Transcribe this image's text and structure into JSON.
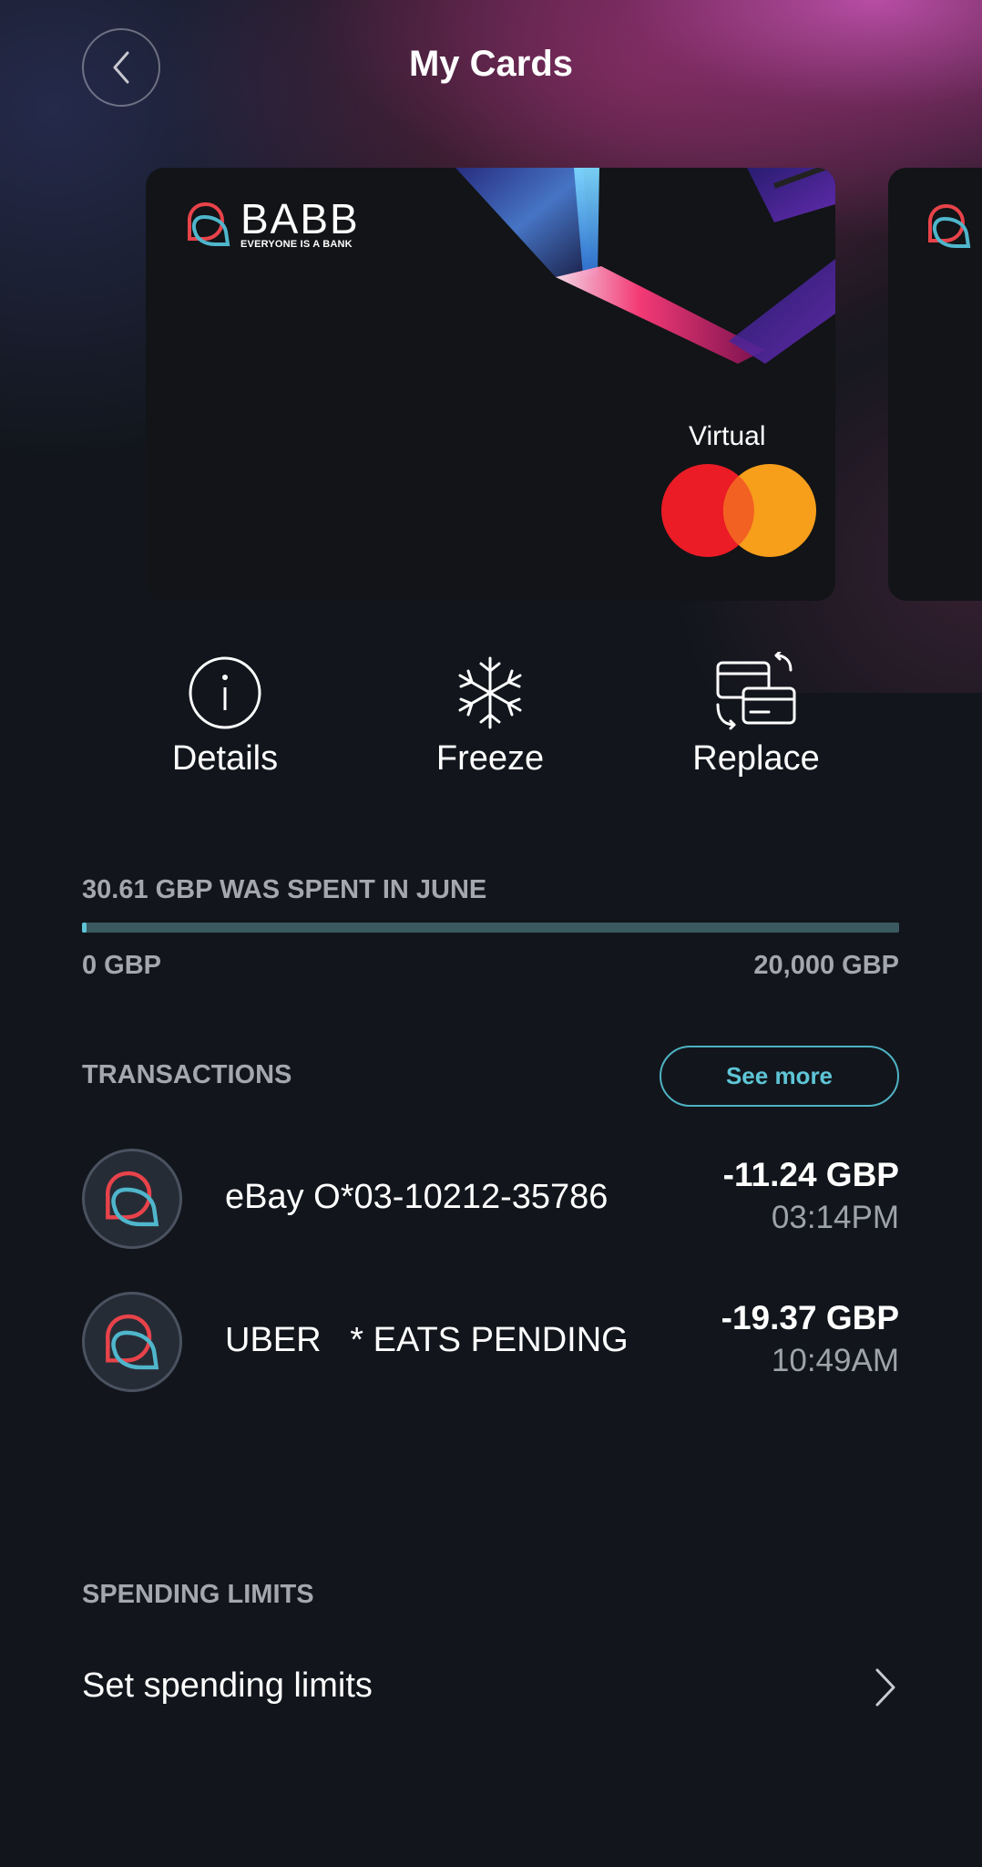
{
  "header": {
    "title": "My Cards",
    "back_icon": "chevron-left-icon"
  },
  "card": {
    "brand_name": "BABB",
    "brand_tagline": "EVERYONE IS A BANK",
    "type_label": "Virtual",
    "network_logo": "mastercard-logo",
    "colors": {
      "mc_red": "#eb001b",
      "mc_orange": "#f79e1b",
      "logo_red": "#e8434a",
      "logo_teal": "#4fb6cc"
    }
  },
  "actions": [
    {
      "label": "Details",
      "icon": "info-icon"
    },
    {
      "label": "Freeze",
      "icon": "snowflake-icon"
    },
    {
      "label": "Replace",
      "icon": "replace-card-icon"
    }
  ],
  "spending": {
    "caption": "30.61 GBP WAS SPENT IN JUNE",
    "min_label": "0 GBP",
    "max_label": "20,000 GBP",
    "spent": 30.61,
    "limit": 20000
  },
  "transactions": {
    "header": "TRANSACTIONS",
    "see_more_label": "See more",
    "items": [
      {
        "merchant": "eBay O*03-10212-35786",
        "amount": "-11.24 GBP",
        "time": "03:14PM"
      },
      {
        "merchant": "UBER   * EATS PENDING",
        "amount": "-19.37 GBP",
        "time": "10:49AM"
      }
    ]
  },
  "spending_limits": {
    "header": "SPENDING LIMITS",
    "row_label": "Set spending limits",
    "chevron_icon": "chevron-right-icon"
  },
  "theme": {
    "background": "#12161c",
    "accent": "#5ec5d6",
    "muted_text": "#a4a8ae"
  }
}
